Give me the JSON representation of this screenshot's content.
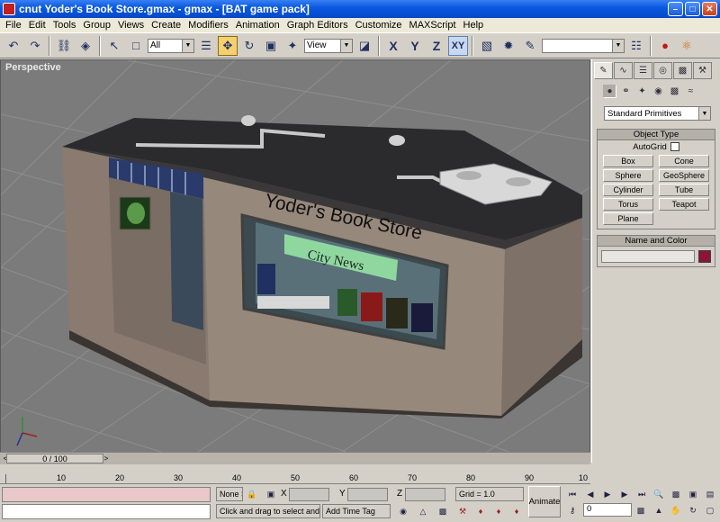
{
  "window": {
    "title": "cnut Yoder's Book Store.gmax - gmax - [BAT game pack]"
  },
  "menu": [
    "File",
    "Edit",
    "Tools",
    "Group",
    "Views",
    "Create",
    "Modifiers",
    "Animation",
    "Graph Editors",
    "Customize",
    "MAXScript",
    "Help"
  ],
  "toolbar": {
    "selection_filter": "All",
    "reference_coord": "View",
    "axes": [
      "X",
      "Y",
      "Z",
      "XY"
    ]
  },
  "viewport": {
    "label": "Perspective",
    "sign_text": "Yoder's Book Store",
    "banner_text": "City News"
  },
  "command_panel": {
    "dropdown": "Standard Primitives",
    "object_type_title": "Object Type",
    "autogrid_label": "AutoGrid",
    "objects": [
      "Box",
      "Cone",
      "Sphere",
      "GeoSphere",
      "Cylinder",
      "Tube",
      "Torus",
      "Teapot",
      "Plane"
    ],
    "name_color_title": "Name and Color",
    "object_color": "#8b1438"
  },
  "timeline": {
    "slider_label": "0 / 100",
    "ticks": [
      "10",
      "20",
      "30",
      "40",
      "50",
      "60",
      "70",
      "80",
      "90",
      "10"
    ]
  },
  "status": {
    "selection": "None S",
    "x_label": "X",
    "y_label": "Y",
    "z_label": "Z",
    "grid": "Grid = 1.0",
    "prompt": "Click and drag to select and m",
    "time_tag": "Add Time Tag",
    "animate": "Animate",
    "frame": "0"
  }
}
